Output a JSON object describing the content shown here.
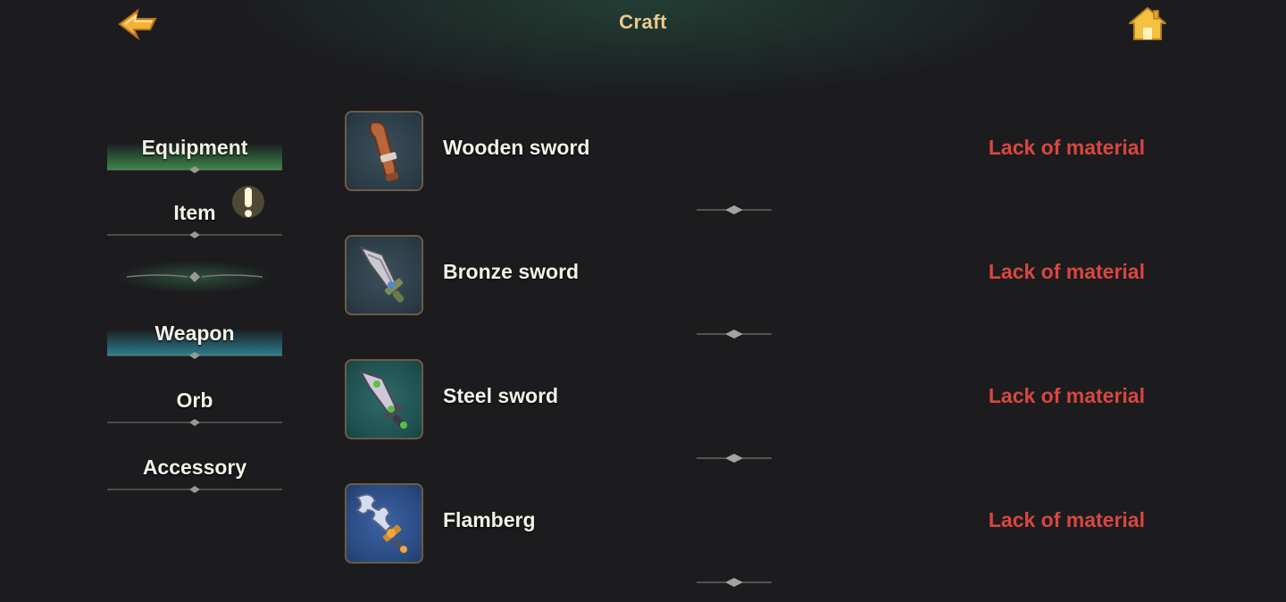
{
  "header": {
    "title": "Craft",
    "back_icon": "back-arrow-icon",
    "home_icon": "home-icon"
  },
  "sidebar": {
    "items": [
      {
        "label": "Equipment",
        "state": "selected"
      },
      {
        "label": "Item",
        "state": "normal",
        "badge_icon": "exclamation-icon"
      },
      {
        "label": "Weapon",
        "state": "selected"
      },
      {
        "label": "Orb",
        "state": "normal"
      },
      {
        "label": "Accessory",
        "state": "normal"
      }
    ]
  },
  "recipes": [
    {
      "name": "Wooden sword",
      "status": "Lack of material",
      "icon": "wooden-sword-icon"
    },
    {
      "name": "Bronze sword",
      "status": "Lack of material",
      "icon": "bronze-sword-icon"
    },
    {
      "name": "Steel sword",
      "status": "Lack of material",
      "icon": "steel-sword-icon"
    },
    {
      "name": "Flamberg",
      "status": "Lack of material",
      "icon": "flamberg-icon"
    }
  ],
  "colors": {
    "background": "#1c1c1f",
    "title": "#e9c98e",
    "status_error": "#d9463f",
    "selected_equipment": "#46aa5a",
    "selected_weapon": "#32a0b4"
  }
}
